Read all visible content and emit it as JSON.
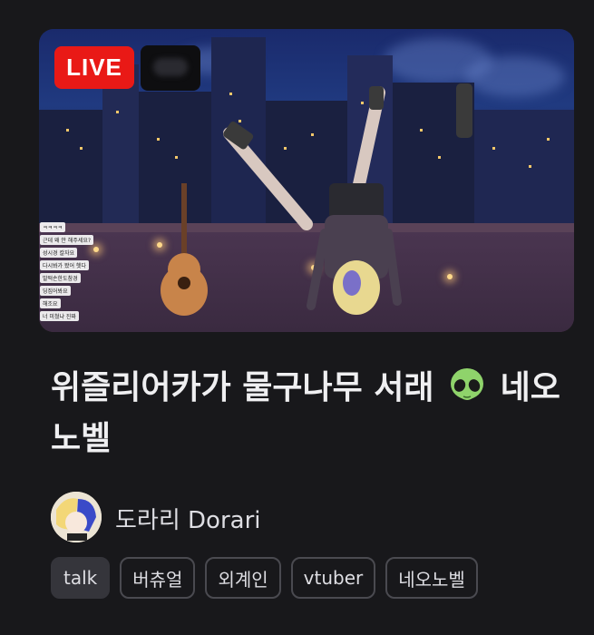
{
  "stream": {
    "live_label": "LIVE",
    "title": "위즐리어카가 물구나무 서래",
    "title_tail": "네오노벨",
    "channel": "도라리 Dorari",
    "tags": [
      "talk",
      "버츄얼",
      "외계인",
      "vtuber",
      "네오노벨"
    ],
    "chat_messages": [
      "ㅋㅋㅋㅋ",
      "근데 왜 안 해주세요?",
      "성시경 칼자요",
      "다시봐가 봤어 헷다",
      "발떡손한도참경",
      "딩집어봐요",
      "해조요",
      "너 미쳤냐 진짜"
    ]
  },
  "colors": {
    "live": "#e91916",
    "background": "#18181b",
    "tag_border": "#4a4a50",
    "tag_active": "#35353b"
  }
}
